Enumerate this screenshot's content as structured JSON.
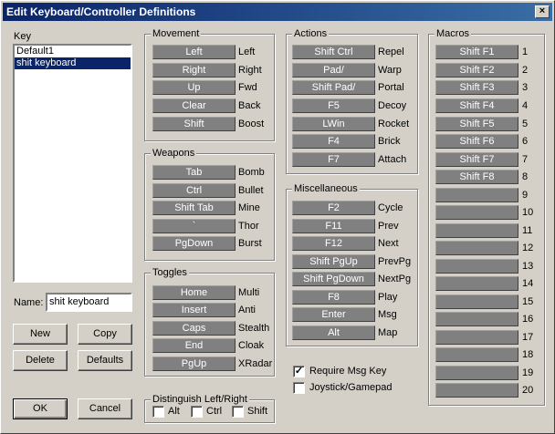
{
  "window": {
    "title": "Edit Keyboard/Controller Definitions",
    "close_glyph": "×"
  },
  "key_panel": {
    "label": "Key",
    "items": [
      {
        "label": "Default1",
        "selected": false
      },
      {
        "label": "shit keyboard",
        "selected": true
      }
    ],
    "name_label": "Name:",
    "name_value": "shit keyboard",
    "buttons": {
      "new": "New",
      "copy": "Copy",
      "delete": "Delete",
      "defaults": "Defaults",
      "ok": "OK",
      "cancel": "Cancel"
    }
  },
  "movement": {
    "title": "Movement",
    "rows": [
      {
        "key": "Left",
        "action": "Left"
      },
      {
        "key": "Right",
        "action": "Right"
      },
      {
        "key": "Up",
        "action": "Fwd"
      },
      {
        "key": "Clear",
        "action": "Back"
      },
      {
        "key": "Shift",
        "action": "Boost"
      }
    ]
  },
  "weapons": {
    "title": "Weapons",
    "rows": [
      {
        "key": "Tab",
        "action": "Bomb"
      },
      {
        "key": "Ctrl",
        "action": "Bullet"
      },
      {
        "key": "Shift Tab",
        "action": "Mine"
      },
      {
        "key": "`",
        "action": "Thor"
      },
      {
        "key": "PgDown",
        "action": "Burst"
      }
    ]
  },
  "toggles": {
    "title": "Toggles",
    "rows": [
      {
        "key": "Home",
        "action": "Multi"
      },
      {
        "key": "Insert",
        "action": "Anti"
      },
      {
        "key": "Caps",
        "action": "Stealth"
      },
      {
        "key": "End",
        "action": "Cloak"
      },
      {
        "key": "PgUp",
        "action": "XRadar"
      }
    ]
  },
  "distinguish": {
    "title": "Distinguish Left/Right",
    "alt": "Alt",
    "ctrl": "Ctrl",
    "shift": "Shift"
  },
  "actions": {
    "title": "Actions",
    "rows": [
      {
        "key": "Shift Ctrl",
        "action": "Repel"
      },
      {
        "key": "Pad/",
        "action": "Warp"
      },
      {
        "key": "Shift Pad/",
        "action": "Portal"
      },
      {
        "key": "F5",
        "action": "Decoy"
      },
      {
        "key": "LWin",
        "action": "Rocket"
      },
      {
        "key": "F4",
        "action": "Brick"
      },
      {
        "key": "F7",
        "action": "Attach"
      }
    ]
  },
  "misc": {
    "title": "Miscellaneous",
    "rows": [
      {
        "key": "F2",
        "action": "Cycle"
      },
      {
        "key": "F11",
        "action": "Prev"
      },
      {
        "key": "F12",
        "action": "Next"
      },
      {
        "key": "Shift PgUp",
        "action": "PrevPg"
      },
      {
        "key": "Shift PgDown",
        "action": "NextPg"
      },
      {
        "key": "F8",
        "action": "Play"
      },
      {
        "key": "Enter",
        "action": "Msg"
      },
      {
        "key": "Alt",
        "action": "Map"
      }
    ]
  },
  "options": {
    "require_msg_key": {
      "label": "Require Msg Key",
      "checked": true,
      "glyph": "✓"
    },
    "joystick": {
      "label": "Joystick/Gamepad",
      "checked": false
    }
  },
  "macros": {
    "title": "Macros",
    "rows": [
      {
        "key": "Shift F1",
        "num": "1"
      },
      {
        "key": "Shift F2",
        "num": "2"
      },
      {
        "key": "Shift F3",
        "num": "3"
      },
      {
        "key": "Shift F4",
        "num": "4"
      },
      {
        "key": "Shift F5",
        "num": "5"
      },
      {
        "key": "Shift F6",
        "num": "6"
      },
      {
        "key": "Shift F7",
        "num": "7"
      },
      {
        "key": "Shift F8",
        "num": "8"
      },
      {
        "key": "",
        "num": "9"
      },
      {
        "key": "",
        "num": "10"
      },
      {
        "key": "",
        "num": "11"
      },
      {
        "key": "",
        "num": "12"
      },
      {
        "key": "",
        "num": "13"
      },
      {
        "key": "",
        "num": "14"
      },
      {
        "key": "",
        "num": "15"
      },
      {
        "key": "",
        "num": "16"
      },
      {
        "key": "",
        "num": "17"
      },
      {
        "key": "",
        "num": "18"
      },
      {
        "key": "",
        "num": "19"
      },
      {
        "key": "",
        "num": "20"
      }
    ]
  }
}
